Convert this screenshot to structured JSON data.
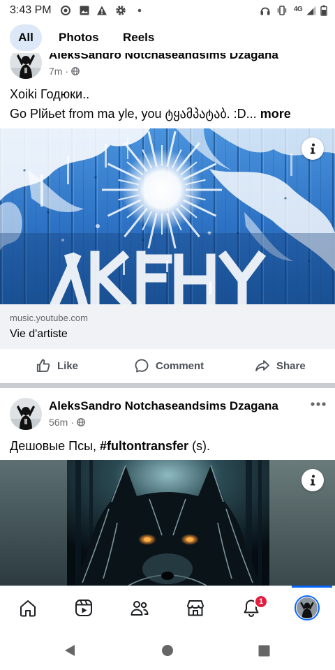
{
  "status_bar": {
    "time": "3:43 PM",
    "network_label": "4G",
    "left_icons": [
      "circle-target-icon",
      "image-icon",
      "warning-icon",
      "settings-gear-icon",
      "dot-icon"
    ],
    "right_icons": [
      "headphones-icon",
      "vibrate-icon",
      "network-4g-icon",
      "signal-icon",
      "battery-icon"
    ]
  },
  "tabs": [
    {
      "label": "All",
      "selected": true
    },
    {
      "label": "Photos",
      "selected": false
    },
    {
      "label": "Reels",
      "selected": false
    }
  ],
  "posts": [
    {
      "author": "AleksSandro Notchaseandsims Dzagana",
      "time": "7m",
      "dot": "·",
      "audience_icon": "globe-icon",
      "text_lines": [
        "Xoiki Годюки..",
        "Go Plйьet from ma yle, you ტყამპატაბ. :D..."
      ],
      "see_more": "more",
      "image_button_icon": "info-icon",
      "link_preview": {
        "domain": "music.youtube.com",
        "title": "Vie d'artiste"
      }
    },
    {
      "author": "AleksSandro Notchaseandsims Dzagana",
      "time": "56m",
      "dot": "·",
      "audience_icon": "globe-icon",
      "menu_icon": "more-dots-icon",
      "text_parts": [
        {
          "text": "Дешовые Псы, ",
          "bold": false
        },
        {
          "text": "#fultontransfer",
          "bold": true
        },
        {
          "text": " (s).",
          "bold": false
        }
      ],
      "image_button_icon": "info-icon"
    }
  ],
  "actions": {
    "like": "Like",
    "comment": "Comment",
    "share": "Share"
  },
  "bottom_nav": {
    "items": [
      "home-icon",
      "video-icon",
      "friends-icon",
      "marketplace-icon",
      "notifications-icon",
      "profile-avatar"
    ],
    "active": "profile-avatar",
    "notification_badge": "1"
  },
  "system_nav": [
    "back-icon",
    "home-circle-icon",
    "recents-square-icon"
  ],
  "colors": {
    "accent": "#0866ff",
    "selected_tab_bg": "#dce7f7",
    "badge": "#e41e3f",
    "text": "#050505",
    "secondary_text": "#65676b",
    "link_card_bg": "#f0f2f5",
    "separator": "#c9ccd1"
  }
}
